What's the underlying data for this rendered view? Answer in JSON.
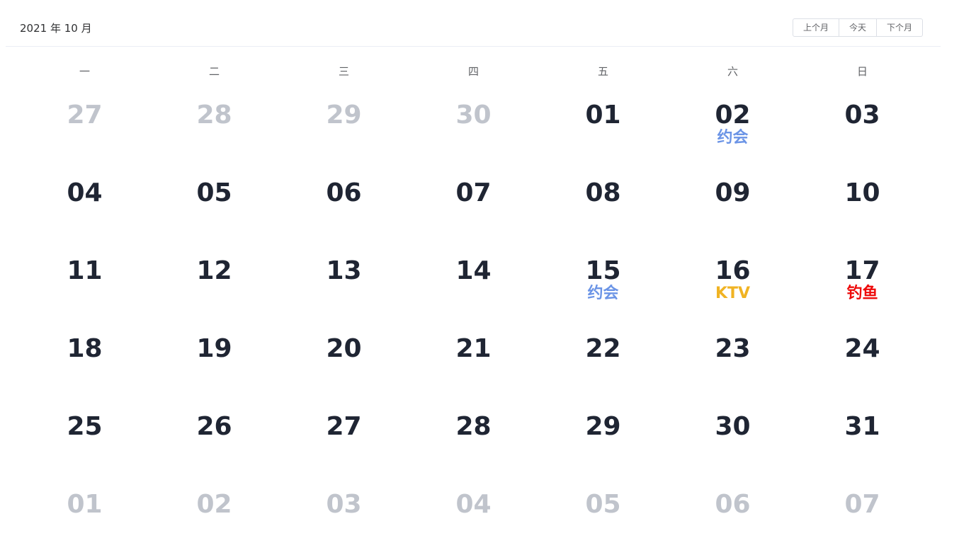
{
  "header": {
    "title": "2021 年 10 月",
    "prev_label": "上个月",
    "today_label": "今天",
    "next_label": "下个月"
  },
  "weekdays": [
    "一",
    "二",
    "三",
    "四",
    "五",
    "六",
    "日"
  ],
  "days": [
    {
      "num": "27",
      "other": true
    },
    {
      "num": "28",
      "other": true
    },
    {
      "num": "29",
      "other": true
    },
    {
      "num": "30",
      "other": true
    },
    {
      "num": "01"
    },
    {
      "num": "02",
      "event": "约会",
      "color": "#6b94e6"
    },
    {
      "num": "03"
    },
    {
      "num": "04"
    },
    {
      "num": "05"
    },
    {
      "num": "06"
    },
    {
      "num": "07"
    },
    {
      "num": "08"
    },
    {
      "num": "09"
    },
    {
      "num": "10"
    },
    {
      "num": "11"
    },
    {
      "num": "12"
    },
    {
      "num": "13"
    },
    {
      "num": "14"
    },
    {
      "num": "15",
      "event": "约会",
      "color": "#6b94e6"
    },
    {
      "num": "16",
      "event": "KTV",
      "color": "#f0b323"
    },
    {
      "num": "17",
      "event": "钓鱼",
      "color": "#ee0a0a"
    },
    {
      "num": "18"
    },
    {
      "num": "19"
    },
    {
      "num": "20"
    },
    {
      "num": "21"
    },
    {
      "num": "22"
    },
    {
      "num": "23"
    },
    {
      "num": "24"
    },
    {
      "num": "25"
    },
    {
      "num": "26"
    },
    {
      "num": "27"
    },
    {
      "num": "28"
    },
    {
      "num": "29"
    },
    {
      "num": "30"
    },
    {
      "num": "31"
    },
    {
      "num": "01",
      "other": true
    },
    {
      "num": "02",
      "other": true
    },
    {
      "num": "03",
      "other": true
    },
    {
      "num": "04",
      "other": true
    },
    {
      "num": "05",
      "other": true
    },
    {
      "num": "06",
      "other": true
    },
    {
      "num": "07",
      "other": true
    }
  ]
}
